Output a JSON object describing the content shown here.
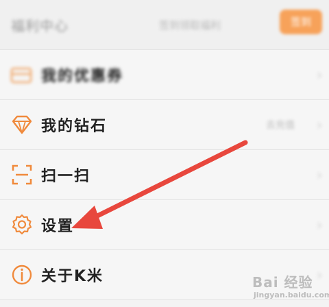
{
  "header": {
    "title": "福利中心",
    "subtitle": "签到领取福利",
    "button_label": "签到"
  },
  "menu": {
    "items": [
      {
        "label": "我的优惠券",
        "icon": "coupon-icon",
        "value": ""
      },
      {
        "label": "我的钻石",
        "icon": "diamond-icon",
        "value": "去充值"
      },
      {
        "label": "扫一扫",
        "icon": "scan-icon",
        "value": ""
      },
      {
        "label": "设置",
        "icon": "gear-icon",
        "value": ""
      },
      {
        "label": "关于K米",
        "icon": "info-icon",
        "value": ""
      }
    ]
  },
  "watermark": {
    "brand": "Bai 经验",
    "url": "jingyan.baidu.com"
  },
  "colors": {
    "accent": "#f08a3c",
    "arrow": "#e8473d"
  }
}
